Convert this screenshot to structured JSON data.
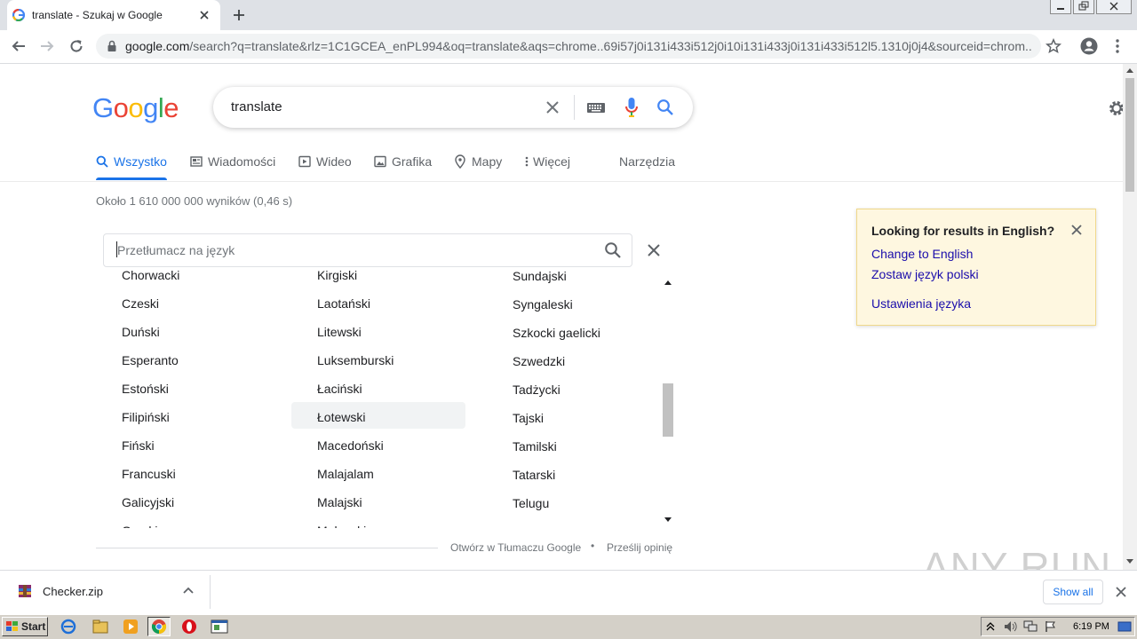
{
  "browser": {
    "tab_title": "translate - Szukaj w Google",
    "url_host": "google.com",
    "url_path": "/search?q=translate&rlz=1C1GCEA_enPL994&oq=translate&aqs=chrome..69i57j0i131i433i512j0i10i131i433j0i131i433i512l5.1310j0j4&sourceid=chrom..."
  },
  "search": {
    "logo": [
      "G",
      "o",
      "o",
      "g",
      "l",
      "e"
    ],
    "query": "translate"
  },
  "nav": {
    "all": "Wszystko",
    "news": "Wiadomości",
    "video": "Wideo",
    "images": "Grafika",
    "maps": "Mapy",
    "more": "Więcej",
    "tools": "Narzędzia"
  },
  "stats": "Około 1 610 000 000 wyników (0,46 s)",
  "translator": {
    "placeholder": "Przetłumacz na język",
    "col1": [
      "Chorwacki",
      "Czeski",
      "Duński",
      "Esperanto",
      "Estoński",
      "Filipiński",
      "Fiński",
      "Francuski",
      "Galicyjski",
      "Grecki"
    ],
    "col2": [
      "Kirgiski",
      "Laotański",
      "Litewski",
      "Luksemburski",
      "Łaciński",
      "Łotewski",
      "Macedoński",
      "Malajalam",
      "Malajski",
      "Malgaski"
    ],
    "col3": [
      "Sundajski",
      "Syngaleski",
      "Szkocki gaelicki",
      "Szwedzki",
      "Tadżycki",
      "Tajski",
      "Tamilski",
      "Tatarski",
      "Telugu"
    ],
    "highlighted": "Łotewski",
    "footer_open": "Otwórz w Tłumaczu Google",
    "footer_sep": "•",
    "footer_feedback": "Prześlij opinię"
  },
  "notice": {
    "title": "Looking for results in English?",
    "change": "Change to English",
    "keep": "Zostaw język polski",
    "settings": "Ustawienia języka"
  },
  "download": {
    "file": "Checker.zip",
    "show_all": "Show all"
  },
  "watermark": "ANY RUN",
  "taskbar": {
    "start": "Start",
    "clock": "6:19 PM"
  },
  "colors": {
    "accent": "#1a73e8",
    "link": "#1a0dab",
    "notice_bg": "#fef7e0"
  }
}
